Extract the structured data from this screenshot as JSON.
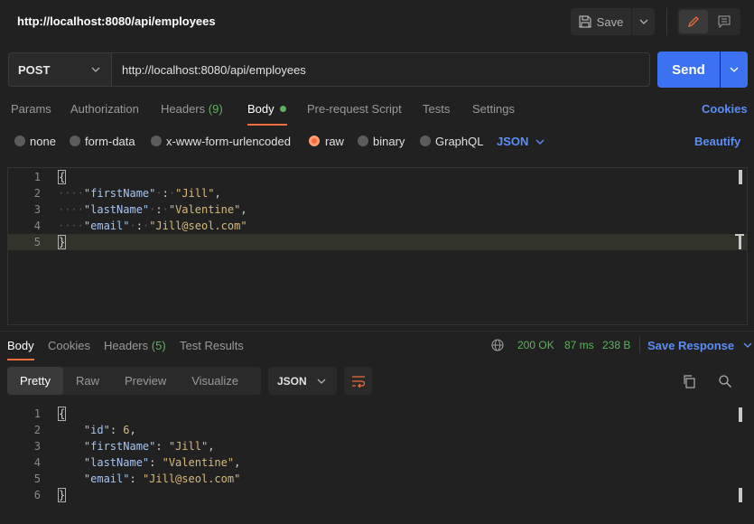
{
  "header": {
    "title": "http://localhost:8080/api/employees",
    "save_label": "Save"
  },
  "request": {
    "method": "POST",
    "url": "http://localhost:8080/api/employees",
    "send_label": "Send"
  },
  "request_tabs": {
    "params": "Params",
    "authorization": "Authorization",
    "headers": "Headers",
    "headers_count": "(9)",
    "body": "Body",
    "pre_request": "Pre-request Script",
    "tests": "Tests",
    "settings": "Settings",
    "cookies": "Cookies"
  },
  "body_types": {
    "none": "none",
    "form_data": "form-data",
    "urlencoded": "x-www-form-urlencoded",
    "raw": "raw",
    "binary": "binary",
    "graphql": "GraphQL",
    "format": "JSON",
    "beautify": "Beautify",
    "selected": "raw"
  },
  "request_body": {
    "line_numbers": [
      "1",
      "2",
      "3",
      "4",
      "5"
    ],
    "open": "{",
    "close": "}",
    "k1": "\"firstName\"",
    "v1": "\"Jill\"",
    "k2": "\"lastName\"",
    "v2": "\"Valentine\"",
    "k3": "\"email\"",
    "v3": "\"Jill@seol.com\""
  },
  "response_tabs": {
    "body": "Body",
    "cookies": "Cookies",
    "headers": "Headers",
    "headers_count": "(5)",
    "test_results": "Test Results"
  },
  "response_meta": {
    "status": "200 OK",
    "time": "87 ms",
    "size": "238 B",
    "save_response": "Save Response"
  },
  "view_tabs": {
    "pretty": "Pretty",
    "raw": "Raw",
    "preview": "Preview",
    "visualize": "Visualize",
    "format": "JSON"
  },
  "response_body": {
    "line_numbers": [
      "1",
      "2",
      "3",
      "4",
      "5",
      "6"
    ],
    "open": "{",
    "close": "}",
    "k0": "\"id\"",
    "v0": "6",
    "k1": "\"firstName\"",
    "v1": "\"Jill\"",
    "k2": "\"lastName\"",
    "v2": "\"Valentine\"",
    "k3": "\"email\"",
    "v3": "\"Jill@seol.com\""
  },
  "colors": {
    "accent": "#3b72f2",
    "active_tab": "#f26b3a",
    "success": "#5fb15f",
    "link": "#5b8ef5"
  }
}
